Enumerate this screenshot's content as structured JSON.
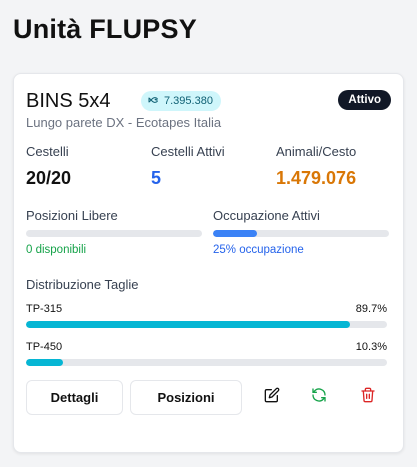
{
  "page": {
    "title": "Unità FLUPSY"
  },
  "unit": {
    "name": "BINS 5x4",
    "animal_count": "7.395.380",
    "status": "Attivo",
    "location": "Lungo parete DX - Ecotapes Italia"
  },
  "stats": [
    {
      "label": "Cestelli",
      "value": "20/20"
    },
    {
      "label": "Cestelli Attivi",
      "value": "5"
    },
    {
      "label": "Animali/Cesto",
      "value": "1.479.076"
    }
  ],
  "occupancy": {
    "free": {
      "label": "Posizioni Libere",
      "note": "0 disponibili",
      "fraction": 0.0
    },
    "active": {
      "label": "Occupazione Attivi",
      "note": "25% occupazione",
      "fraction": 0.25
    }
  },
  "distribution": {
    "title": "Distribuzione Taglie",
    "items": [
      {
        "size": "TP-315",
        "percent_label": "89.7%",
        "fraction": 0.897
      },
      {
        "size": "TP-450",
        "percent_label": "10.3%",
        "fraction": 0.103
      }
    ]
  },
  "actions": {
    "details_label": "Dettagli",
    "positions_label": "Posizioni",
    "edit_icon": "edit-icon",
    "refresh_icon": "refresh-icon",
    "delete_icon": "trash-icon"
  },
  "colors": {
    "badge_bg": "#cff6fb",
    "status_bg": "#111827",
    "blue": "#2563eb",
    "orange": "#d97706",
    "green": "#16a34a",
    "cyan": "#06b6d4",
    "red": "#dc2626"
  }
}
